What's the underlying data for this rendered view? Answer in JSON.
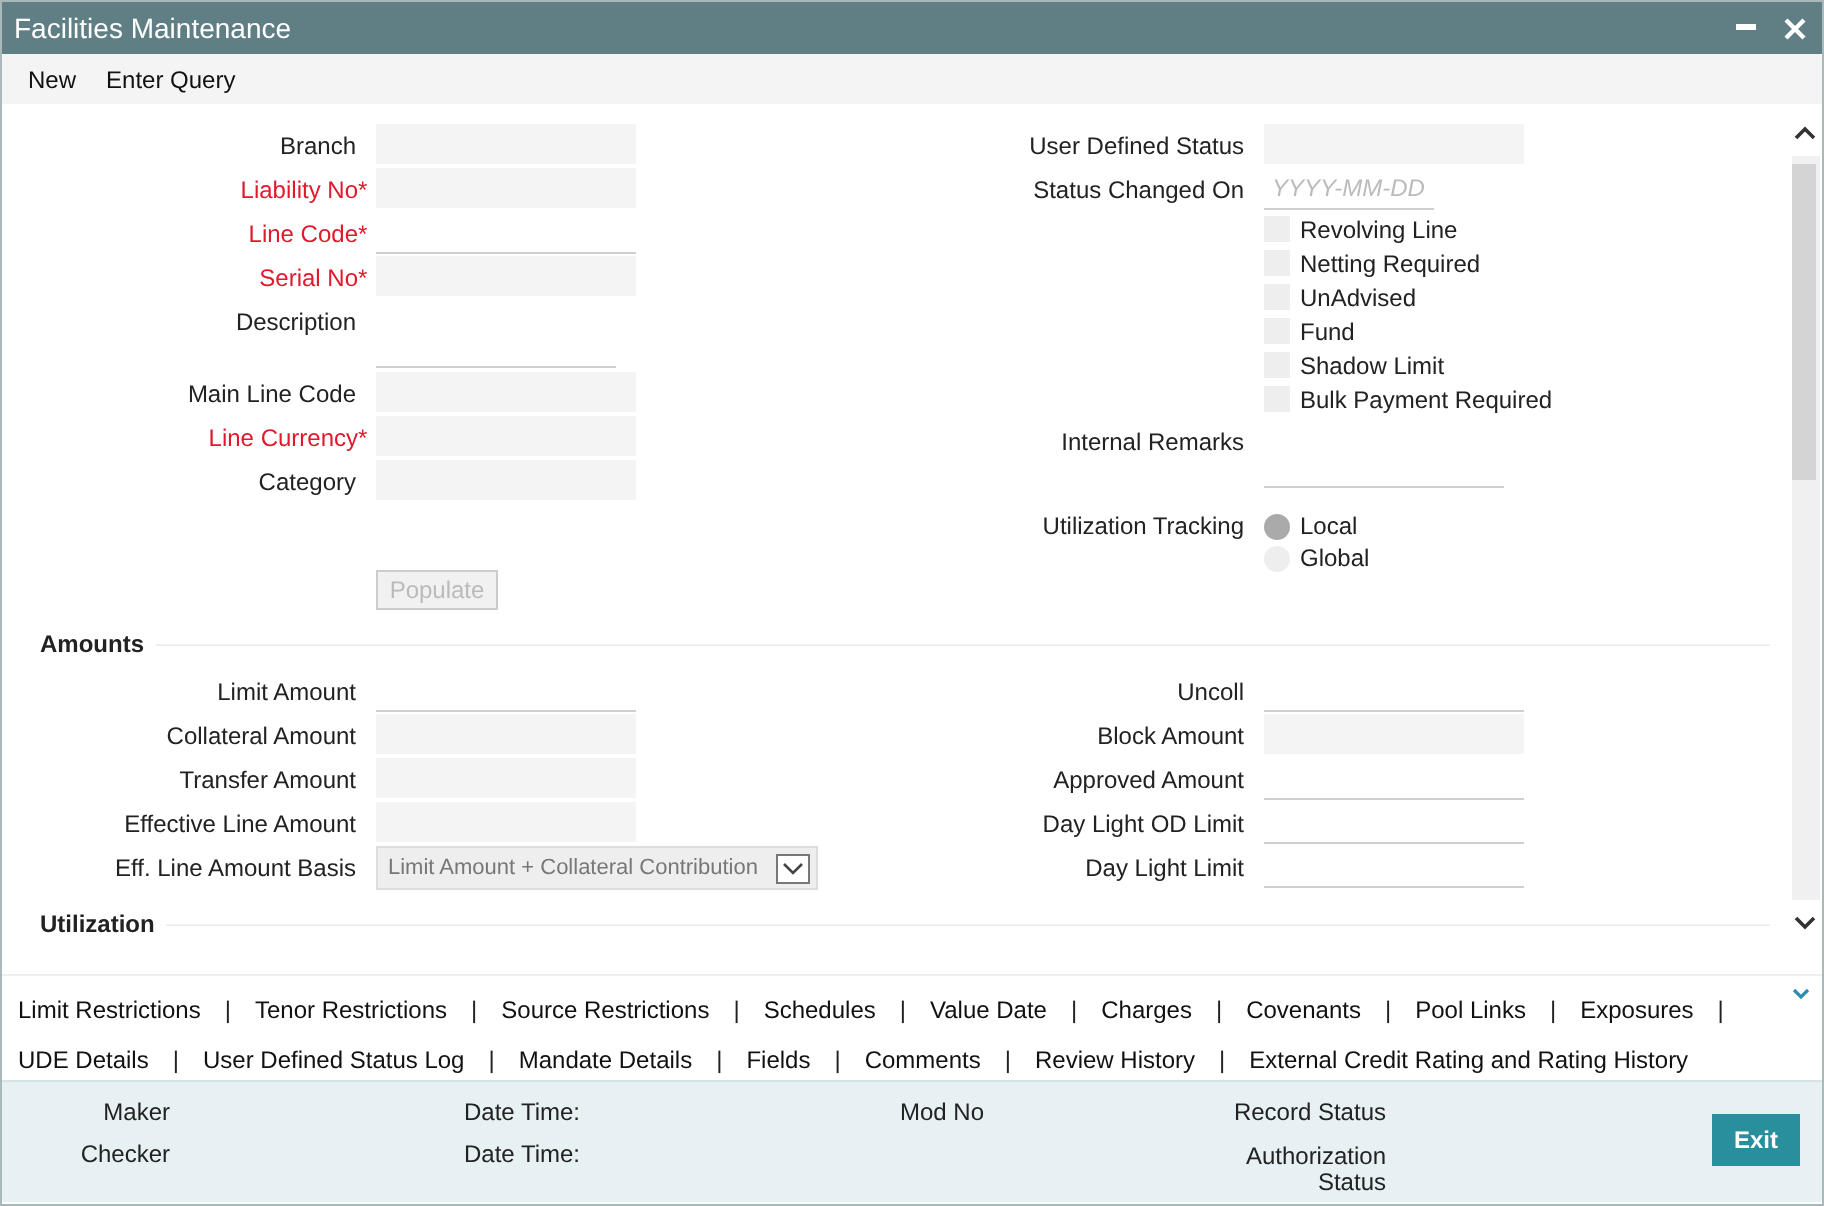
{
  "window": {
    "title": "Facilities Maintenance"
  },
  "menu": [
    {
      "label": "New"
    },
    {
      "label": "Enter Query"
    }
  ],
  "required_mark": "*",
  "main": {
    "left_fields": [
      {
        "label": "Branch",
        "required": false,
        "kind": "filled"
      },
      {
        "label": "Liability No",
        "required": true,
        "kind": "filled"
      },
      {
        "label": "Line Code",
        "required": true,
        "kind": "line"
      },
      {
        "label": "Serial No",
        "required": true,
        "kind": "filled"
      },
      {
        "label": "Description",
        "required": false,
        "kind": "textarea"
      },
      {
        "label": "Main Line Code",
        "required": false,
        "kind": "filled"
      },
      {
        "label": "Line Currency",
        "required": true,
        "kind": "filled"
      },
      {
        "label": "Category",
        "required": false,
        "kind": "filled"
      }
    ],
    "populate_button": {
      "label": "Populate",
      "disabled": true
    },
    "right_fields": [
      {
        "label": "User Defined Status",
        "kind": "filled"
      },
      {
        "label": "Status Changed On",
        "kind": "date",
        "placeholder": "YYYY-MM-DD"
      }
    ],
    "checkboxes": [
      {
        "label": "Revolving Line",
        "checked": false
      },
      {
        "label": "Netting Required",
        "checked": false
      },
      {
        "label": "UnAdvised",
        "checked": false
      },
      {
        "label": "Fund",
        "checked": false
      },
      {
        "label": "Shadow Limit",
        "checked": false
      },
      {
        "label": "Bulk Payment Required",
        "checked": false
      }
    ],
    "internal_remarks": {
      "label": "Internal Remarks",
      "kind": "textarea"
    },
    "utilization_tracking": {
      "label": "Utilization Tracking",
      "options": [
        {
          "label": "Local",
          "selected": true
        },
        {
          "label": "Global",
          "selected": false
        }
      ]
    }
  },
  "amounts": {
    "heading": "Amounts",
    "left_fields": [
      {
        "label": "Limit Amount",
        "kind": "line"
      },
      {
        "label": "Collateral Amount",
        "kind": "filled"
      },
      {
        "label": "Transfer Amount",
        "kind": "filled"
      },
      {
        "label": "Effective Line Amount",
        "kind": "filled"
      },
      {
        "label": "Eff. Line Amount Basis",
        "kind": "select",
        "value": "Limit Amount + Collateral Contribution"
      }
    ],
    "right_fields": [
      {
        "label": "Uncoll",
        "kind": "line"
      },
      {
        "label": "Block Amount",
        "kind": "filled"
      },
      {
        "label": "Approved Amount",
        "kind": "line"
      },
      {
        "label": "Day Light OD Limit",
        "kind": "line"
      },
      {
        "label": "Day Light Limit",
        "kind": "line"
      }
    ]
  },
  "utilization": {
    "heading": "Utilization"
  },
  "links": {
    "separator": "|",
    "rows": [
      [
        "Limit Restrictions",
        "Tenor Restrictions",
        "Source Restrictions",
        "Schedules",
        "Value Date",
        "Charges",
        "Covenants",
        "Pool Links",
        "Exposures"
      ],
      [
        "UDE Details",
        "User Defined Status Log",
        "Mandate Details",
        "Fields",
        "Comments",
        "Review History",
        "External Credit Rating and Rating History"
      ]
    ]
  },
  "footer": {
    "columns": [
      {
        "lines": [
          "Maker",
          "Checker"
        ]
      },
      {
        "lines": [
          "Date Time:",
          "Date Time:"
        ]
      },
      {
        "lines": [
          "Mod No"
        ]
      },
      {
        "lines": [
          "Record Status",
          "Authorization Status"
        ]
      }
    ],
    "exit_button": {
      "label": "Exit"
    }
  }
}
